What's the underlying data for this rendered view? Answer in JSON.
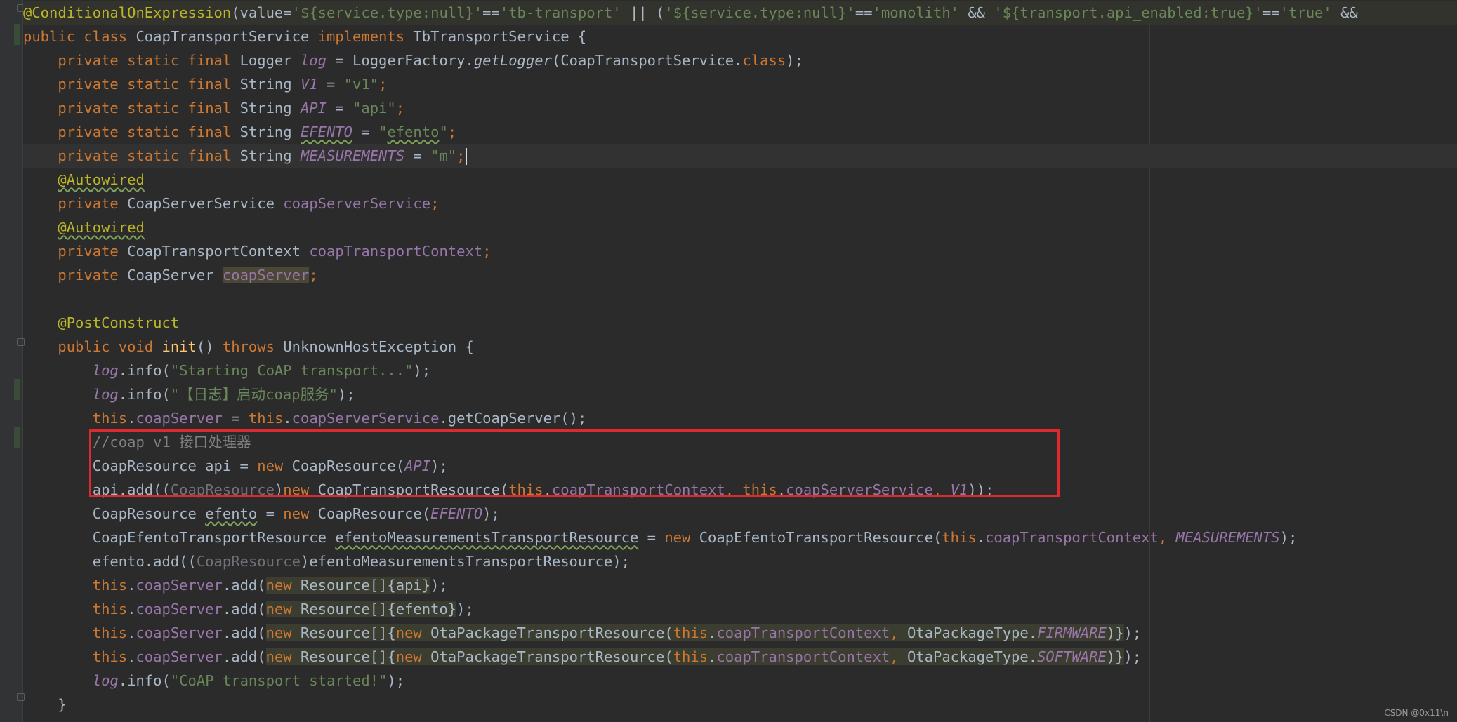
{
  "editor": {
    "lines": [
      {
        "tokens": [
          [
            "ann",
            "@ConditionalOnExpression"
          ],
          [
            "p",
            "(value="
          ],
          [
            "str",
            "'${service.type:null}'"
          ],
          [
            "p",
            "=="
          ],
          [
            "str",
            "'tb-transport'"
          ],
          [
            "p",
            " || ("
          ],
          [
            "str",
            "'${service.type:null}'"
          ],
          [
            "p",
            "=="
          ],
          [
            "str",
            "'monolith'"
          ],
          [
            "p",
            " && "
          ],
          [
            "str",
            "'${transport.api_enabled:true}'"
          ],
          [
            "p",
            "=="
          ],
          [
            "str",
            "'true'"
          ],
          [
            "p",
            " &&"
          ]
        ]
      },
      {
        "tokens": [
          [
            "kw",
            "public class "
          ],
          [
            "p",
            "CoapTransportService "
          ],
          [
            "kw",
            "implements "
          ],
          [
            "p",
            "TbTransportService {"
          ]
        ]
      },
      {
        "tokens": [
          [
            "p",
            "    "
          ],
          [
            "kw",
            "private static final "
          ],
          [
            "p",
            "Logger "
          ],
          [
            "sf",
            "log"
          ],
          [
            "p",
            " = LoggerFactory."
          ],
          [
            "sm",
            "getLogger"
          ],
          [
            "p",
            "(CoapTransportService."
          ],
          [
            "kw",
            "class"
          ],
          [
            "p",
            ");"
          ]
        ]
      },
      {
        "tokens": [
          [
            "p",
            "    "
          ],
          [
            "kw",
            "private static final "
          ],
          [
            "p",
            "String "
          ],
          [
            "sf",
            "V1"
          ],
          [
            "p",
            " = "
          ],
          [
            "str",
            "\"v1\""
          ],
          [
            "kw",
            ";"
          ]
        ]
      },
      {
        "tokens": [
          [
            "p",
            "    "
          ],
          [
            "kw",
            "private static final "
          ],
          [
            "p",
            "String "
          ],
          [
            "sf",
            "API"
          ],
          [
            "p",
            " = "
          ],
          [
            "str",
            "\"api\""
          ],
          [
            "kw",
            ";"
          ]
        ]
      },
      {
        "tokens": [
          [
            "p",
            "    "
          ],
          [
            "kw",
            "private static final "
          ],
          [
            "p",
            "String "
          ],
          [
            "sf ul",
            "EFENTO"
          ],
          [
            "p",
            " = "
          ],
          [
            "str",
            "\""
          ],
          [
            "str ul",
            "efento"
          ],
          [
            "str",
            "\""
          ],
          [
            "kw",
            ";"
          ]
        ]
      },
      {
        "tokens": [
          [
            "p",
            "    "
          ],
          [
            "kw",
            "private static final "
          ],
          [
            "p",
            "String "
          ],
          [
            "sf",
            "MEASUREMENTS"
          ],
          [
            "p",
            " = "
          ],
          [
            "str",
            "\"m\""
          ],
          [
            "kw",
            ";"
          ],
          [
            "caret",
            ""
          ]
        ]
      },
      {
        "tokens": [
          [
            "p",
            "    "
          ],
          [
            "ann ul",
            "@Autowired"
          ]
        ]
      },
      {
        "tokens": [
          [
            "p",
            "    "
          ],
          [
            "kw",
            "private "
          ],
          [
            "p",
            "CoapServerService "
          ],
          [
            "fld",
            "coapServerService"
          ],
          [
            "kw",
            ";"
          ]
        ]
      },
      {
        "tokens": [
          [
            "p",
            "    "
          ],
          [
            "ann ul",
            "@Autowired"
          ]
        ]
      },
      {
        "tokens": [
          [
            "p",
            "    "
          ],
          [
            "kw",
            "private "
          ],
          [
            "p",
            "CoapTransportContext "
          ],
          [
            "fld",
            "coapTransportContext"
          ],
          [
            "kw",
            ";"
          ]
        ]
      },
      {
        "tokens": [
          [
            "p",
            "    "
          ],
          [
            "kw",
            "private "
          ],
          [
            "p",
            "CoapServer "
          ],
          [
            "fld hl",
            "coapServer"
          ],
          [
            "kw",
            ";"
          ]
        ]
      },
      {
        "tokens": []
      },
      {
        "tokens": [
          [
            "p",
            "    "
          ],
          [
            "ann",
            "@PostConstruct"
          ]
        ]
      },
      {
        "tokens": [
          [
            "p",
            "    "
          ],
          [
            "kw",
            "public void "
          ],
          [
            "mth",
            "init"
          ],
          [
            "p",
            "() "
          ],
          [
            "kw",
            "throws "
          ],
          [
            "p",
            "UnknownHostException {"
          ]
        ]
      },
      {
        "tokens": [
          [
            "p",
            "        "
          ],
          [
            "sf",
            "log"
          ],
          [
            "p",
            ".info("
          ],
          [
            "str",
            "\"Starting CoAP transport...\""
          ],
          [
            "p",
            ");"
          ]
        ]
      },
      {
        "tokens": [
          [
            "p",
            "        "
          ],
          [
            "sf",
            "log"
          ],
          [
            "p",
            ".info("
          ],
          [
            "str",
            "\"【日志】启动coap服务\""
          ],
          [
            "p",
            ");"
          ]
        ]
      },
      {
        "tokens": [
          [
            "p",
            "        "
          ],
          [
            "kw",
            "this"
          ],
          [
            "p",
            "."
          ],
          [
            "fld",
            "coapServer"
          ],
          [
            "p",
            " = "
          ],
          [
            "kw",
            "this"
          ],
          [
            "p",
            "."
          ],
          [
            "fld",
            "coapServerService"
          ],
          [
            "p",
            ".getCoapServer();"
          ]
        ]
      },
      {
        "tokens": [
          [
            "p",
            "        "
          ],
          [
            "cmt",
            "//coap v1 接口处理器"
          ]
        ]
      },
      {
        "tokens": [
          [
            "p",
            "        CoapResource api = "
          ],
          [
            "kw",
            "new "
          ],
          [
            "p",
            "CoapResource("
          ],
          [
            "sf",
            "API"
          ],
          [
            "p",
            ");"
          ]
        ]
      },
      {
        "tokens": [
          [
            "p",
            "        api.add(("
          ],
          [
            "dim",
            "CoapResource"
          ],
          [
            "p",
            ")"
          ],
          [
            "kw",
            "new "
          ],
          [
            "p",
            "CoapTransportResource("
          ],
          [
            "kw",
            "this"
          ],
          [
            "p",
            "."
          ],
          [
            "fld",
            "coapTransportContext"
          ],
          [
            "kw",
            ", this"
          ],
          [
            "p",
            "."
          ],
          [
            "fld",
            "coapServerService"
          ],
          [
            "kw",
            ", "
          ],
          [
            "sf",
            "V1"
          ],
          [
            "p",
            "));"
          ]
        ]
      },
      {
        "tokens": [
          [
            "p",
            "        CoapResource "
          ],
          [
            "ul",
            "efento"
          ],
          [
            "p",
            " = "
          ],
          [
            "kw",
            "new "
          ],
          [
            "p",
            "CoapResource("
          ],
          [
            "sf",
            "EFENTO"
          ],
          [
            "p",
            ");"
          ]
        ]
      },
      {
        "tokens": [
          [
            "p",
            "        CoapEfentoTransportResource "
          ],
          [
            "ul",
            "efentoMeasurementsTransportResource"
          ],
          [
            "p",
            " = "
          ],
          [
            "kw",
            "new "
          ],
          [
            "p",
            "CoapEfentoTransportResource("
          ],
          [
            "kw",
            "this"
          ],
          [
            "p",
            "."
          ],
          [
            "fld",
            "coapTransportContext"
          ],
          [
            "kw",
            ", "
          ],
          [
            "sf",
            "MEASUREMENTS"
          ],
          [
            "p",
            ");"
          ]
        ]
      },
      {
        "tokens": [
          [
            "p",
            "        efento.add(("
          ],
          [
            "dim",
            "CoapResource"
          ],
          [
            "p",
            ")efentoMeasurementsTransportResource);"
          ]
        ]
      },
      {
        "tokens": [
          [
            "p",
            "        "
          ],
          [
            "kw",
            "this"
          ],
          [
            "p",
            "."
          ],
          [
            "fld",
            "coapServer"
          ],
          [
            "p",
            ".add("
          ],
          [
            "kw hlg",
            "new "
          ],
          [
            "p hlg",
            "Resource[]{api}"
          ],
          [
            "p",
            ");"
          ]
        ]
      },
      {
        "tokens": [
          [
            "p",
            "        "
          ],
          [
            "kw",
            "this"
          ],
          [
            "p",
            "."
          ],
          [
            "fld",
            "coapServer"
          ],
          [
            "p",
            ".add("
          ],
          [
            "kw hlg",
            "new "
          ],
          [
            "p hlg",
            "Resource[]{efento}"
          ],
          [
            "p",
            ");"
          ]
        ]
      },
      {
        "tokens": [
          [
            "p",
            "        "
          ],
          [
            "kw",
            "this"
          ],
          [
            "p",
            "."
          ],
          [
            "fld",
            "coapServer"
          ],
          [
            "p",
            ".add("
          ],
          [
            "kw hlg",
            "new "
          ],
          [
            "p hlg",
            "Resource[]{"
          ],
          [
            "kw hlg",
            "new "
          ],
          [
            "p hlg",
            "OtaPackageTransportResource("
          ],
          [
            "kw hlg",
            "this"
          ],
          [
            "p hlg",
            "."
          ],
          [
            "fld hlg",
            "coapTransportContext"
          ],
          [
            "kw hlg",
            ", "
          ],
          [
            "p hlg",
            "OtaPackageType."
          ],
          [
            "sf hlg",
            "FIRMWARE"
          ],
          [
            "p hlg",
            ")}"
          ],
          [
            "p",
            ");"
          ]
        ]
      },
      {
        "tokens": [
          [
            "p",
            "        "
          ],
          [
            "kw",
            "this"
          ],
          [
            "p",
            "."
          ],
          [
            "fld",
            "coapServer"
          ],
          [
            "p",
            ".add("
          ],
          [
            "kw hlg",
            "new "
          ],
          [
            "p hlg",
            "Resource[]{"
          ],
          [
            "kw hlg",
            "new "
          ],
          [
            "p hlg",
            "OtaPackageTransportResource("
          ],
          [
            "kw hlg",
            "this"
          ],
          [
            "p hlg",
            "."
          ],
          [
            "fld hlg",
            "coapTransportContext"
          ],
          [
            "kw hlg",
            ", "
          ],
          [
            "p hlg",
            "OtaPackageType."
          ],
          [
            "sf hlg",
            "SOFTWARE"
          ],
          [
            "p hlg",
            ")}"
          ],
          [
            "p",
            ");"
          ]
        ]
      },
      {
        "tokens": [
          [
            "p",
            "        "
          ],
          [
            "sf",
            "log"
          ],
          [
            "p",
            ".info("
          ],
          [
            "str",
            "\"CoAP transport started!\""
          ],
          [
            "p",
            ");"
          ]
        ]
      },
      {
        "tokens": [
          [
            "p",
            "    }"
          ]
        ]
      }
    ],
    "current_line": 6
  },
  "watermark": "CSDN @0x11\\n",
  "colors": {
    "background": "#2b2b2b",
    "keyword": "#cc7832",
    "annotation": "#bbb529",
    "string": "#6a8759",
    "field": "#9876aa",
    "comment": "#808080",
    "highlight_box": "#e0292f"
  }
}
